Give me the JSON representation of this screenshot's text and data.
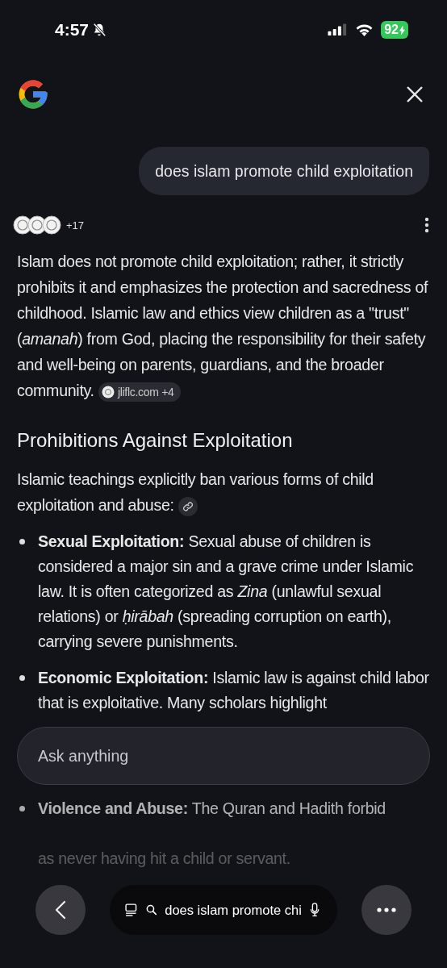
{
  "status_bar": {
    "time": "4:57",
    "battery": "92"
  },
  "query": "does islam promote child exploitation",
  "sources": {
    "count": "+17"
  },
  "answer": {
    "text": "Islam does not promote child exploitation; rather, it strictly prohibits it and emphasizes the protection and sacredness of childhood. Islamic law and ethics view children as a \"trust\" (*amanah*) from God, placing the responsibility for their safety and well-being on parents, guardians, and the broader community.",
    "citation": "jliflc.com +4"
  },
  "section": {
    "heading": "Prohibitions Against Exploitation",
    "intro": "Islamic teachings explicitly ban various forms of child exploitation and abuse:"
  },
  "bullets": [
    {
      "title": "Sexual Exploitation:",
      "text": "Sexual abuse of children is considered a major sin and a grave crime under Islamic law. It is often categorized as *Zina* (unlawful sexual relations) or *ḥirābah* (spreading corruption on earth), carrying severe punishments."
    },
    {
      "title": "Economic Exploitation:",
      "text": "Islamic law is against child labor that is exploitative. Many scholars highlight"
    },
    {
      "title": "Violence and Abuse:",
      "text": "The Quran and Hadith forbid",
      "tail": "as never having hit a child or servant."
    }
  ],
  "ask": {
    "placeholder": "Ask anything"
  },
  "bottom_bar": {
    "search": "does islam promote chi"
  }
}
